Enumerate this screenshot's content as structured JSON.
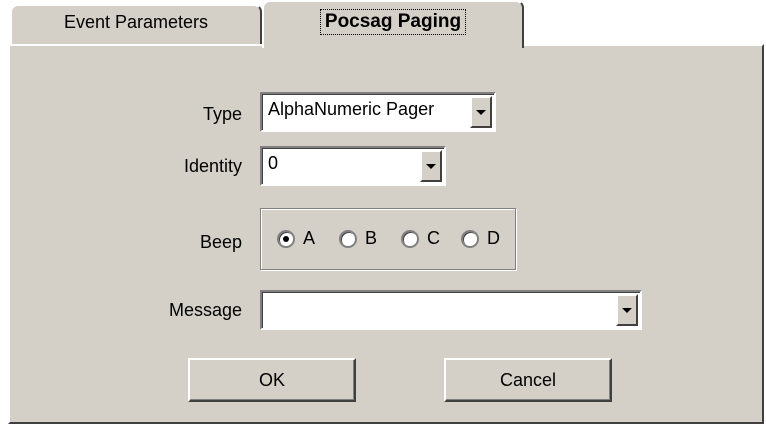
{
  "tabs": [
    {
      "label": "Event Parameters",
      "active": false
    },
    {
      "label": "Pocsag Paging",
      "active": true
    }
  ],
  "form": {
    "type": {
      "label": "Type",
      "value": "AlphaNumeric Pager"
    },
    "identity": {
      "label": "Identity",
      "value": "0"
    },
    "beep": {
      "label": "Beep",
      "options": [
        "A",
        "B",
        "C",
        "D"
      ],
      "selected": "A"
    },
    "message": {
      "label": "Message",
      "value": ""
    }
  },
  "buttons": {
    "ok": "OK",
    "cancel": "Cancel"
  },
  "colors": {
    "face": "#d4d0c8",
    "highlight": "#ffffff",
    "shadow": "#808080",
    "dark_shadow": "#404040"
  },
  "icons": {
    "dropdown": "chevron-down-icon",
    "radio": "radio-button-icon"
  }
}
